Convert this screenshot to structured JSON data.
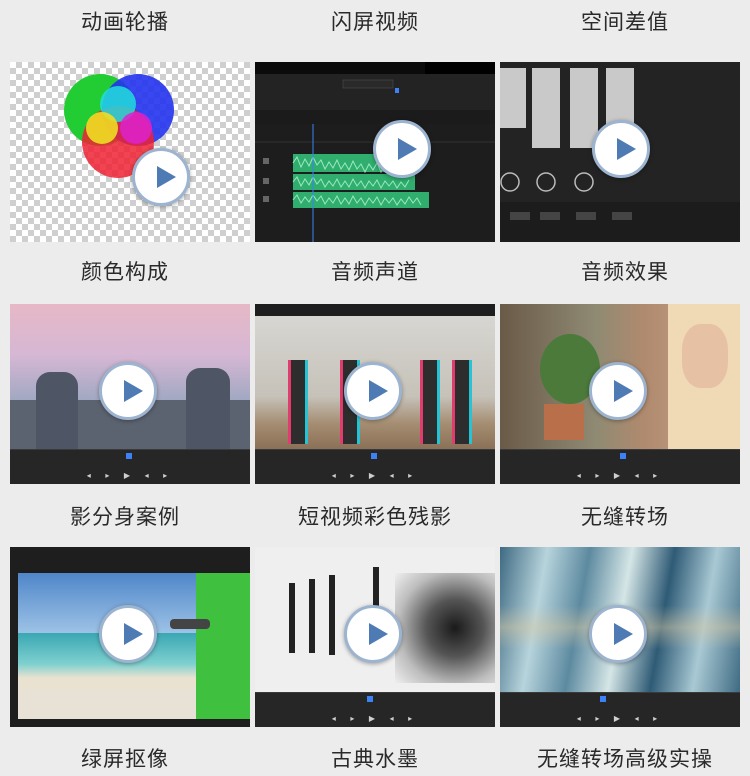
{
  "tiles": [
    {
      "label": "动画轮播"
    },
    {
      "label": "闪屏视频"
    },
    {
      "label": "空间差值"
    },
    {
      "label": "颜色构成"
    },
    {
      "label": "音频声道"
    },
    {
      "label": "音频效果"
    },
    {
      "label": "影分身案例"
    },
    {
      "label": "短视频彩色残影"
    },
    {
      "label": "无缝转场"
    },
    {
      "label": "绿屏抠像"
    },
    {
      "label": "古典水墨"
    },
    {
      "label": "无缝转场高级实操"
    }
  ],
  "colors": {
    "accent": "#4f7bb5",
    "play_ring": "#9db4d1",
    "green_screen": "#3fc13f"
  }
}
